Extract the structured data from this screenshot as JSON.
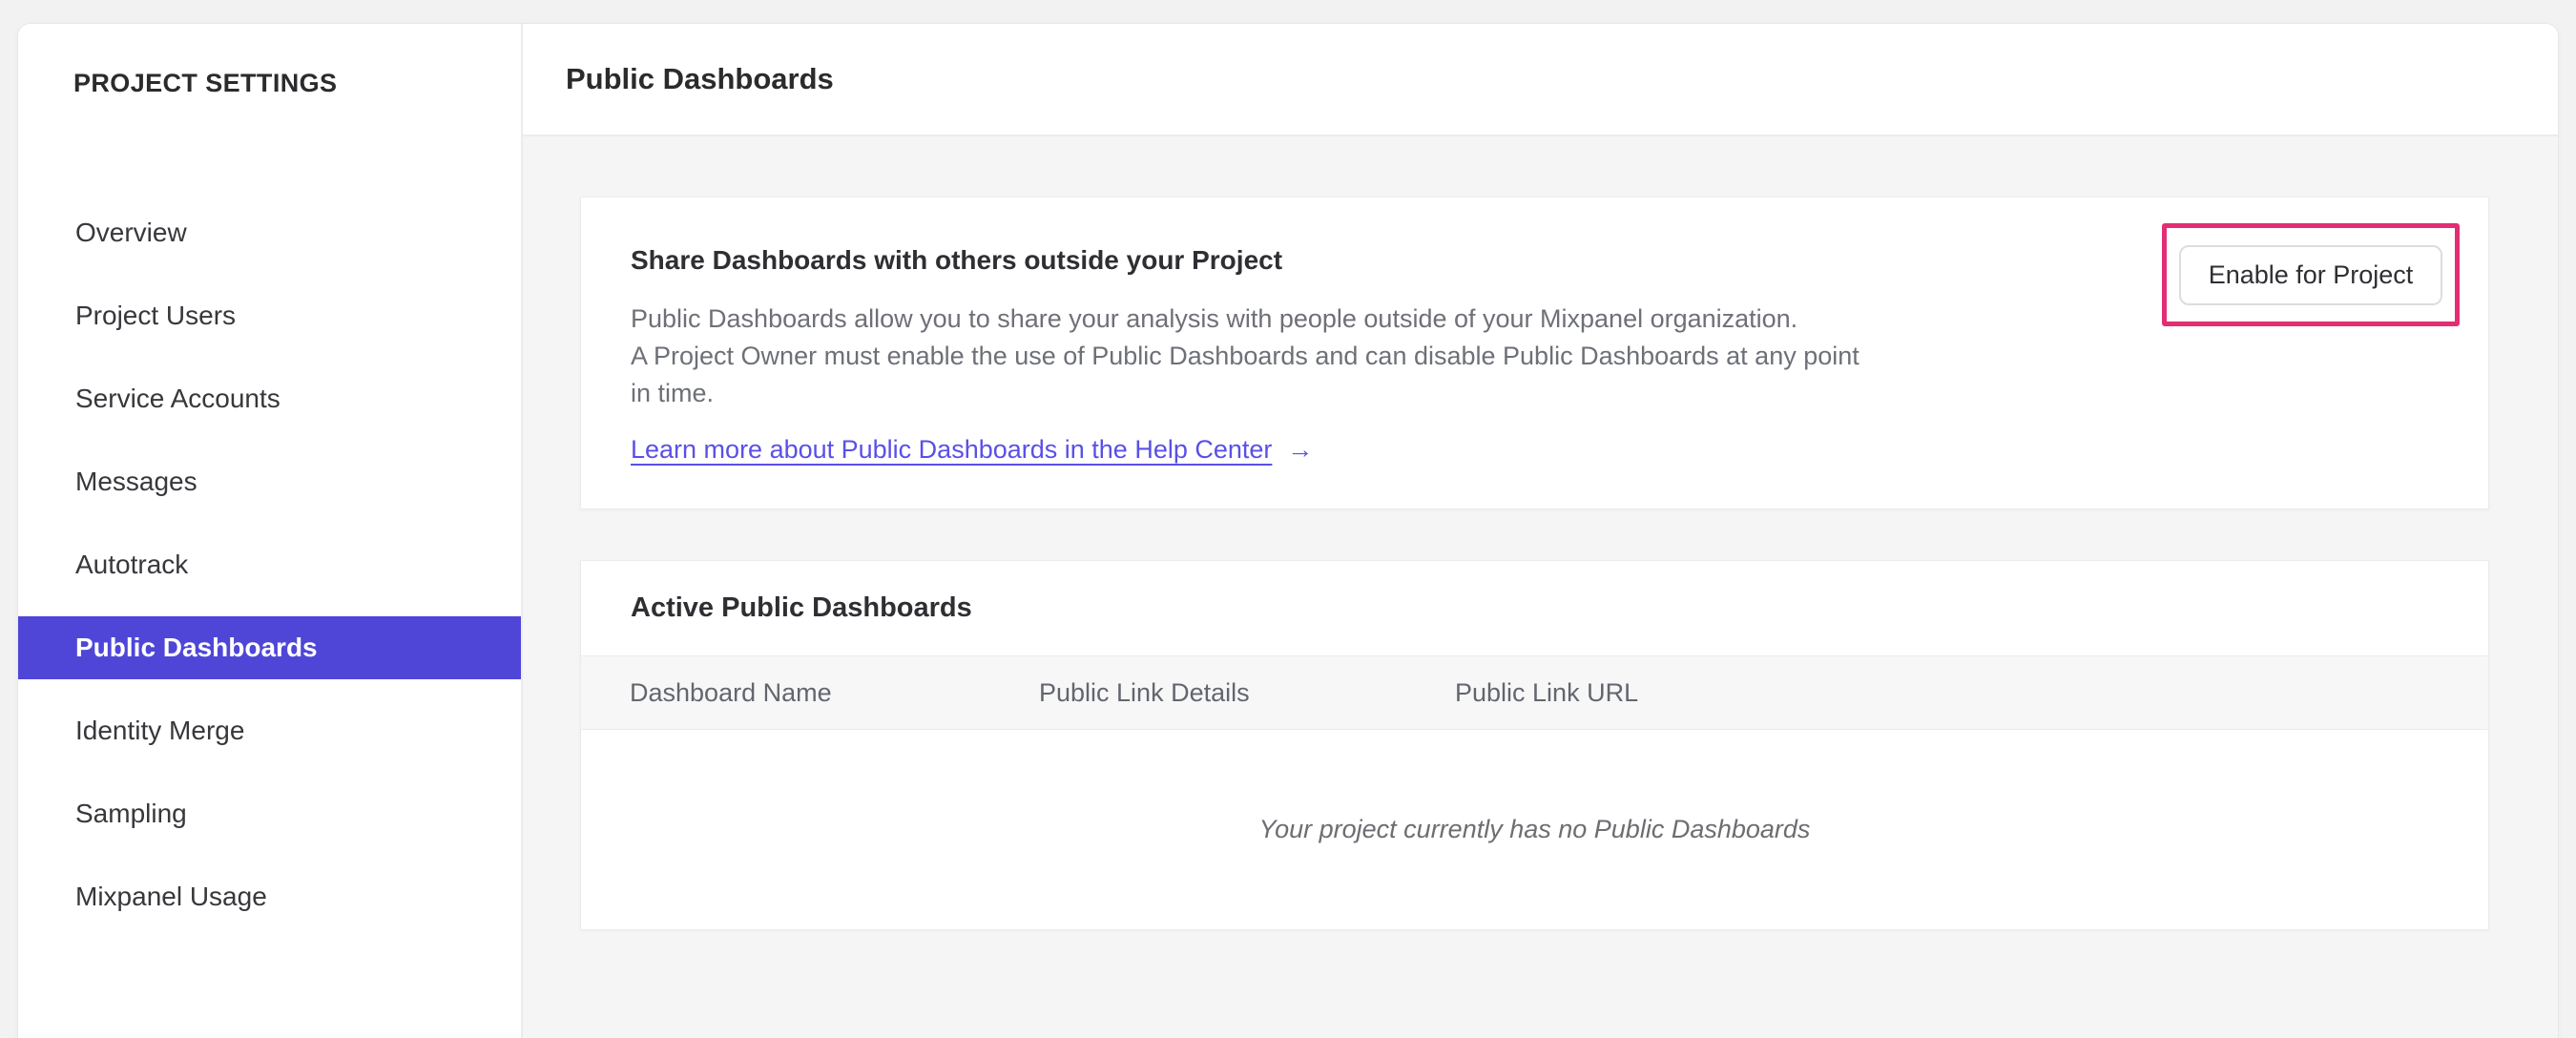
{
  "colors": {
    "accent": "#4f46d8",
    "link": "#5a50e6",
    "annotation": "#e32d74",
    "page-bg": "#f2f2f3",
    "content-bg": "#f5f5f6"
  },
  "sidebar": {
    "title": "PROJECT SETTINGS",
    "items": [
      {
        "label": "Overview",
        "active": false
      },
      {
        "label": "Project Users",
        "active": false
      },
      {
        "label": "Service Accounts",
        "active": false
      },
      {
        "label": "Messages",
        "active": false
      },
      {
        "label": "Autotrack",
        "active": false
      },
      {
        "label": "Public Dashboards",
        "active": true
      },
      {
        "label": "Identity Merge",
        "active": false
      },
      {
        "label": "Sampling",
        "active": false
      },
      {
        "label": "Mixpanel Usage",
        "active": false
      }
    ]
  },
  "header": {
    "title": "Public Dashboards"
  },
  "share_card": {
    "title": "Share Dashboards with others outside your Project",
    "body_lines": [
      "Public Dashboards allow you to share your analysis with people outside of your Mixpanel organization.",
      "A Project Owner must enable the use of Public Dashboards and can disable Public Dashboards at any point",
      "in time."
    ],
    "link_label": "Learn more about Public Dashboards in the Help Center",
    "link_arrow": "→",
    "button_label": "Enable for Project"
  },
  "dashboards_card": {
    "title": "Active Public Dashboards",
    "columns": [
      "Dashboard Name",
      "Public Link Details",
      "Public Link URL"
    ],
    "empty_message": "Your project currently has no Public Dashboards"
  }
}
